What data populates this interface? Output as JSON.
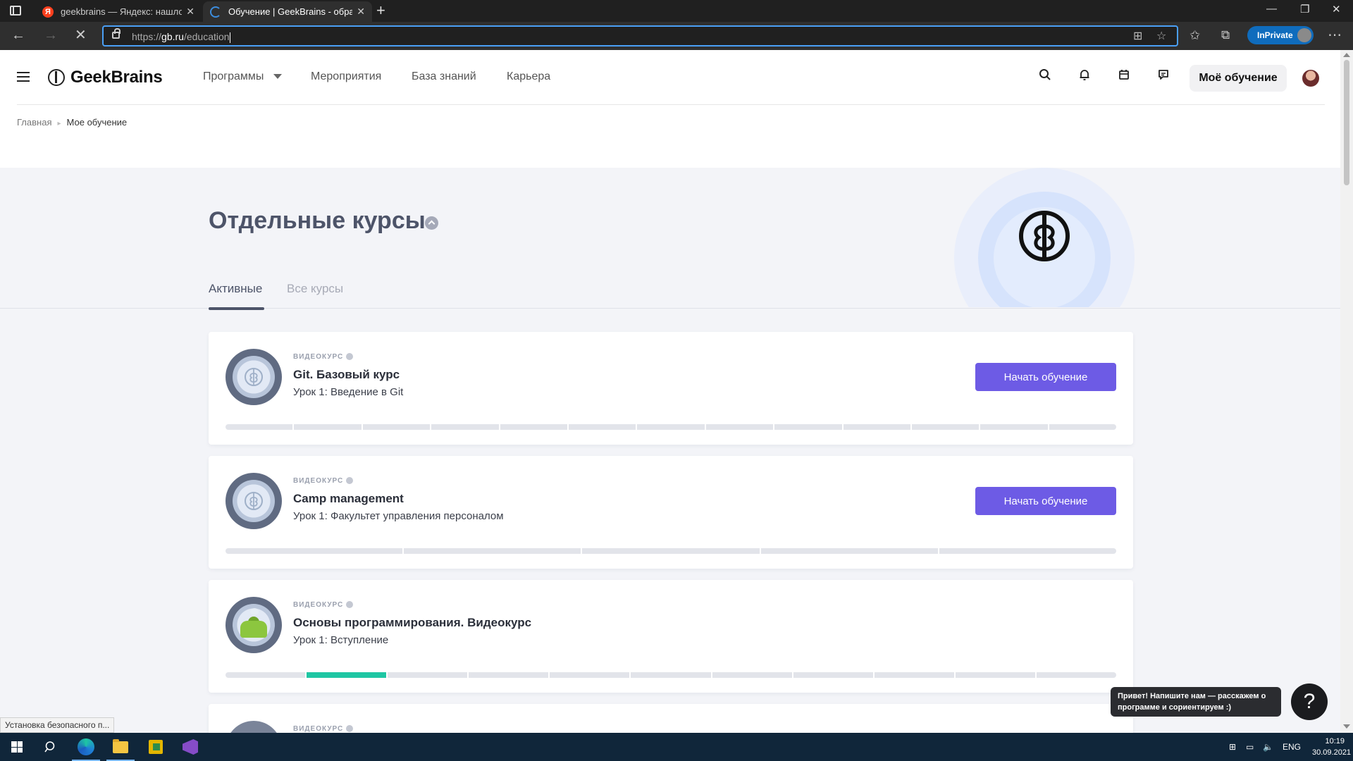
{
  "browser": {
    "tabs": [
      {
        "title": "geekbrains — Яндекс: нашлось",
        "favicon": "yandex-icon",
        "active": false
      },
      {
        "title": "Обучение | GeekBrains - образ",
        "favicon": "loading-icon",
        "active": true
      }
    ],
    "url_prefix": "https://",
    "url_domain": "gb.ru",
    "url_path": "/education",
    "inprivate_label": "InPrivate"
  },
  "header": {
    "logo": "GeekBrains",
    "menu": [
      "Программы",
      "Мероприятия",
      "База знаний",
      "Карьера"
    ],
    "my_learning_button": "Моё обучение"
  },
  "breadcrumb": {
    "home": "Главная",
    "current": "Мое обучение"
  },
  "page": {
    "title": "Отдельные курсы",
    "tabs": [
      "Активные",
      "Все курсы"
    ],
    "active_tab": "Активные"
  },
  "courses": [
    {
      "kind": "ВИДЕОКУРС",
      "name": "Git. Базовый курс",
      "lesson": "Урок 1: Введение в Git",
      "button": "Начать обучение",
      "segments_total": 13,
      "segments_done": []
    },
    {
      "kind": "ВИДЕОКУРС",
      "name": "Camp management",
      "lesson": "Урок 1: Факультет управления персоналом",
      "button": "Начать обучение",
      "segments_total": 5,
      "segments_done": []
    },
    {
      "kind": "ВИДЕОКУРС",
      "name": "Основы программирования. Видеокурс",
      "lesson": "Урок 1: Вступление",
      "button": "",
      "segments_total": 11,
      "segments_done": [
        1
      ]
    },
    {
      "kind": "ВИДЕОКУРС",
      "name": "",
      "lesson": "",
      "button": "",
      "segments_total": 0,
      "segments_done": []
    }
  ],
  "chat": {
    "message": "Привет! Напишите нам — расскажем о программе и сориентируем :)",
    "button": "?"
  },
  "status_bar": "Установка безопасного п...",
  "taskbar": {
    "language": "ENG",
    "time": "10:19",
    "date": "30.09.2021"
  },
  "colors": {
    "accent": "#6d5be5",
    "progress_done": "#1ec6a3",
    "title": "#4d5469"
  }
}
